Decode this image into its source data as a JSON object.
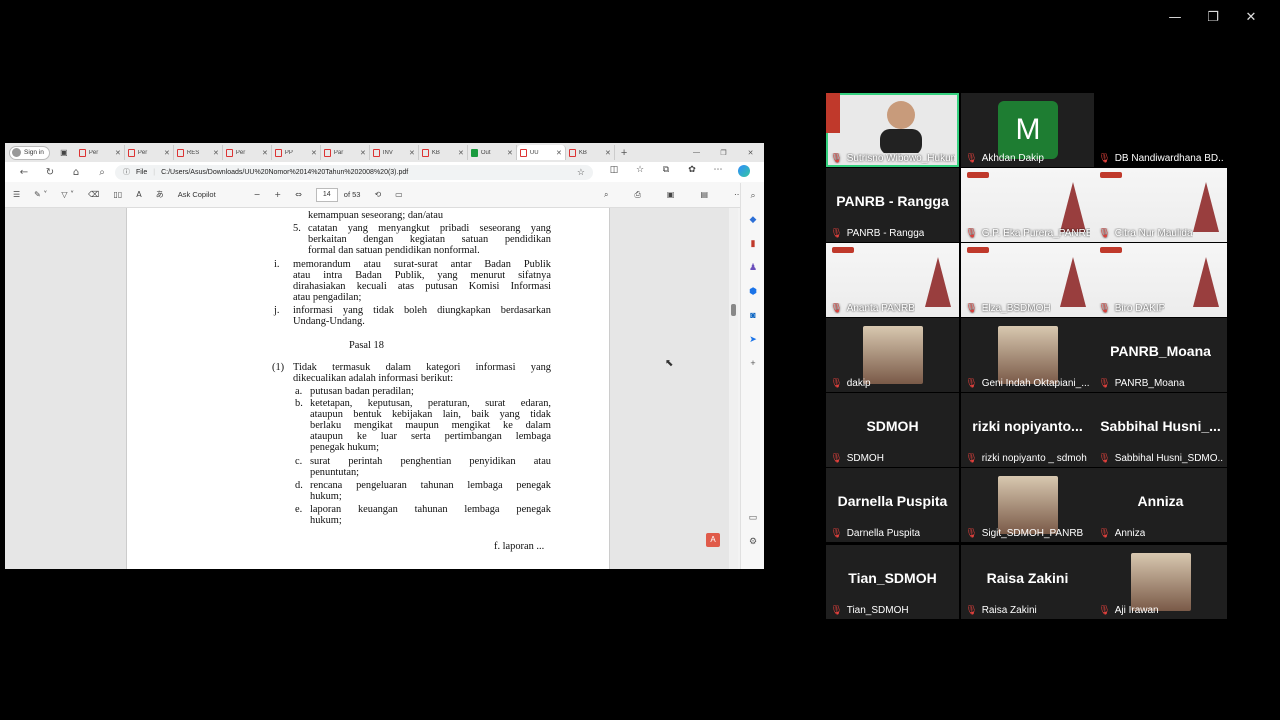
{
  "window_controls": {
    "minimize": "—",
    "restore": "❐",
    "close": "✕"
  },
  "browser": {
    "profile_label": "Sign in",
    "tabs": [
      {
        "label": "Per",
        "icon": "pdf"
      },
      {
        "label": "Per",
        "icon": "pdf"
      },
      {
        "label": "RES",
        "icon": "pdf"
      },
      {
        "label": "Per",
        "icon": "pdf"
      },
      {
        "label": "PP",
        "icon": "pdf"
      },
      {
        "label": "Par",
        "icon": "pdf"
      },
      {
        "label": "INV",
        "icon": "pdf"
      },
      {
        "label": "KB",
        "icon": "pdf"
      },
      {
        "label": "Out",
        "icon": "sheet"
      },
      {
        "label": "UU",
        "icon": "pdf",
        "active": true
      },
      {
        "label": "KB",
        "icon": "pdf"
      }
    ],
    "address": {
      "prefix": "File",
      "url": "C:/Users/Asus/Downloads/UU%20Nomor%2014%20Tahun%202008%20(3).pdf"
    },
    "pdf_toolbar": {
      "ask_copilot": "Ask Copilot",
      "page_current": "14",
      "page_total": "of 53"
    }
  },
  "document": {
    "lines_top": [
      "kemampuan seseorang; dan/atau"
    ],
    "item5_num": "5.",
    "item5_lines": [
      "catatan yang menyangkut pribadi seseorang yang",
      "berkaitan dengan kegiatan satuan pendidikan",
      "formal dan satuan pendidikan nonformal."
    ],
    "item_i_num": "i.",
    "item_i_lines": [
      "memorandum atau surat-surat antar Badan Publik",
      "atau intra Badan Publik, yang menurut sifatnya",
      "dirahasiakan kecuali atas putusan Komisi Informasi",
      "atau pengadilan;"
    ],
    "item_j_num": "j.",
    "item_j_lines": [
      "informasi yang tidak boleh diungkapkan berdasarkan",
      "Undang-Undang."
    ],
    "heading": "Pasal 18",
    "para1_num": "(1)",
    "para1_lines": [
      "Tidak termasuk dalam kategori informasi yang",
      "dikecualikan adalah informasi berikut:"
    ],
    "sub_a_num": "a.",
    "sub_a": "putusan badan peradilan;",
    "sub_b_num": "b.",
    "sub_b_lines": [
      "ketetapan, keputusan, peraturan, surat edaran,",
      "ataupun bentuk kebijakan lain, baik yang tidak",
      "berlaku mengikat maupun mengikat ke dalam",
      "ataupun ke luar serta pertimbangan lembaga",
      "penegak hukum;"
    ],
    "sub_c_num": "c.",
    "sub_c_lines": [
      "surat perintah penghentian penyidikan atau",
      "penuntutan;"
    ],
    "sub_d_num": "d.",
    "sub_d_lines": [
      "rencana pengeluaran tahunan lembaga penegak",
      "hukum;"
    ],
    "sub_e_num": "e.",
    "sub_e_lines": [
      "laporan keuangan tahunan lembaga penegak",
      "hukum;"
    ],
    "footer": "f. laporan ..."
  },
  "participants": [
    {
      "name": "Sutrisno Wibowo_Hukum...",
      "tile": "video",
      "speaking": true
    },
    {
      "name": "Akhdan Dakip",
      "tile": "avatar",
      "avatar_letter": "M",
      "avatar_color": "#1e7d32"
    },
    {
      "name": "DB Nandiwardhana BD...",
      "tile": "black"
    },
    {
      "name": "PANRB - Rangga",
      "tile": "text",
      "big": "PANRB - Rangga"
    },
    {
      "name": "G.P. Eka Purera_PANRB",
      "tile": "slide"
    },
    {
      "name": "Citra Nur Maulida",
      "tile": "slide"
    },
    {
      "name": "Ananta PANRB",
      "tile": "slide"
    },
    {
      "name": "Elza_BSDMOH",
      "tile": "slide"
    },
    {
      "name": "Biro DAKIP",
      "tile": "slide"
    },
    {
      "name": "dakip",
      "tile": "photo"
    },
    {
      "name": "Geni Indah Oktapiani_...",
      "tile": "photo"
    },
    {
      "name": "PANRB_Moana",
      "tile": "text",
      "big": "PANRB_Moana"
    },
    {
      "name": "SDMOH",
      "tile": "text",
      "big": "SDMOH"
    },
    {
      "name": "rizki nopiyanto _ sdmoh",
      "tile": "text",
      "big": "rizki nopiyanto..."
    },
    {
      "name": "Sabbihal Husni_SDMO...",
      "tile": "text",
      "big": "Sabbihal Husni_..."
    },
    {
      "name": "Darnella Puspita",
      "tile": "text",
      "big": "Darnella Puspita"
    },
    {
      "name": "Sigit_SDMOH_PANRB",
      "tile": "photo"
    },
    {
      "name": "Anniza",
      "tile": "text",
      "big": "Anniza"
    },
    {
      "name": "Tian_SDMOH",
      "tile": "text",
      "big": "Tian_SDMOH"
    },
    {
      "name": "Raisa Zakini",
      "tile": "text",
      "big": "Raisa Zakini"
    },
    {
      "name": "Aji Irawan",
      "tile": "photo"
    }
  ]
}
